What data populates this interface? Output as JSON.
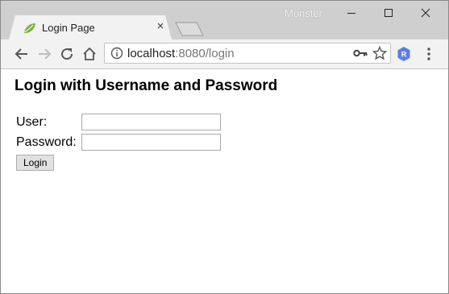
{
  "browser": {
    "tab_title": "Login Page",
    "tab_close": "×",
    "profile_name": "Monster",
    "url_host": "localhost",
    "url_rest": ":8080/login",
    "extension_letter": "R",
    "colors": {
      "titlebar": "#cfcfcf",
      "toolbar": "#f2f2f2",
      "extension": "#5a7de8",
      "favicon": "#7cb342"
    }
  },
  "page": {
    "heading": "Login with Username and Password",
    "user_label": "User:",
    "user_value": "",
    "password_label": "Password:",
    "password_value": "",
    "login_button": "Login"
  }
}
